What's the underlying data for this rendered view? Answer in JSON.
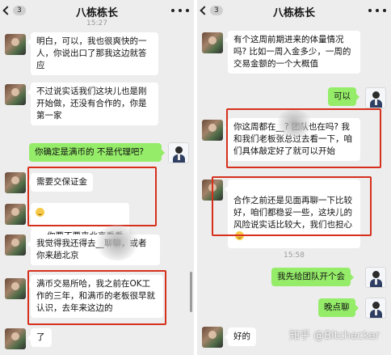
{
  "left": {
    "title": "八栋栋长",
    "back_count": "3",
    "time": "15:27",
    "messages": [
      {
        "text": "明白，可以，我也很爽快的一人，你说出口了那我这边就答应"
      },
      {
        "text": "不过说实话我们这块儿也是刚开始做，还没有合作的，你是第一家"
      },
      {
        "text": "你确定是满币的 不是代理吧?"
      },
      {
        "text": "需要交保证金"
      },
      {
        "text": "你要不要来北京看看"
      },
      {
        "text": "我觉得我还得去__聊聊，或者你来趟北京"
      },
      {
        "text": "满币交易所哈，我之前在OK工作的三年，和满币的老板很早就认识，去年来这边的"
      },
      {
        "text": "了"
      }
    ]
  },
  "right": {
    "title": "八栋栋长",
    "back_count": "3",
    "time": "15:58",
    "messages": [
      {
        "text": "有个这周前期进来的体量情况吗? 比如一周入金多少，一周的交易金额的一个大概值"
      },
      {
        "text": "可以"
      },
      {
        "text": "你这周都在__? 团队也在吗? 我和我们老板张总过去看一下，咱们具体敲定好了就可以开始"
      },
      {
        "text": "合作之前还是见面再聊一下比较好，咱们都稳妥一些，这块儿的风险说实话比较大，我们也担心"
      },
      {
        "text": "我先给团队开个会"
      },
      {
        "text": "晚点聊"
      },
      {
        "text": "好的"
      }
    ]
  },
  "watermark": "知乎 @Bitchecker",
  "colors": {
    "bubble_self": "#95ec69",
    "bubble_other": "#ffffff",
    "highlight_box": "#d6301d",
    "chat_bg": "#ededed"
  }
}
